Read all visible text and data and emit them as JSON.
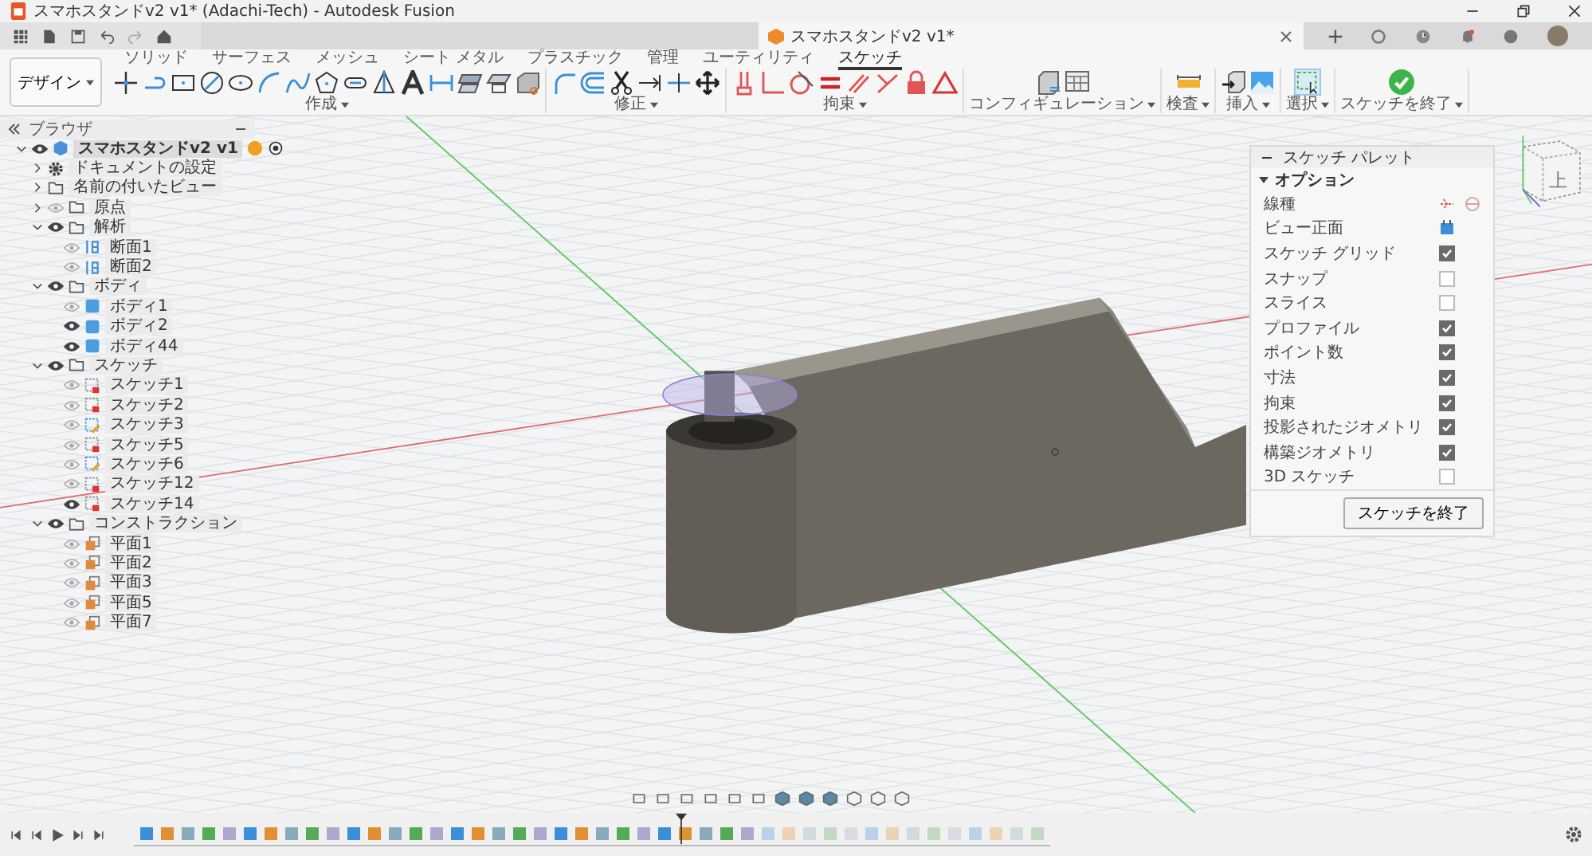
{
  "window": {
    "title": "スマホスタンドv2 v1* (Adachi-Tech) - Autodesk Fusion"
  },
  "document_tab": {
    "title": "スマホスタンドv2 v1*"
  },
  "workspace": {
    "label": "デザイン"
  },
  "toolbar_tabs": [
    {
      "label": "ソリッド",
      "selected": false
    },
    {
      "label": "サーフェス",
      "selected": false
    },
    {
      "label": "メッシュ",
      "selected": false
    },
    {
      "label": "シート メタル",
      "selected": false
    },
    {
      "label": "プラスチック",
      "selected": false
    },
    {
      "label": "管理",
      "selected": false
    },
    {
      "label": "ユーティリティ",
      "selected": false
    },
    {
      "label": "スケッチ",
      "selected": true
    }
  ],
  "tool_groups": [
    {
      "label": "作成"
    },
    {
      "label": "修正"
    },
    {
      "label": "拘束"
    },
    {
      "label": "コンフィギュレーション"
    },
    {
      "label": "検査"
    },
    {
      "label": "挿入"
    },
    {
      "label": "選択"
    },
    {
      "label": "スケッチを終了"
    }
  ],
  "browser": {
    "title": "ブラウザ",
    "root": {
      "label": "スマホスタンドv2 v1",
      "kind": "component",
      "visible": true,
      "expanded": true,
      "children": [
        {
          "label": "ドキュメントの設定",
          "kind": "settings",
          "expanded": false
        },
        {
          "label": "名前の付いたビュー",
          "kind": "folder",
          "expanded": false
        },
        {
          "label": "原点",
          "kind": "folder",
          "visible": false,
          "expanded": false
        },
        {
          "label": "解析",
          "kind": "folder",
          "visible": true,
          "expanded": true,
          "children": [
            {
              "label": "断面1",
              "kind": "section",
              "visible": false
            },
            {
              "label": "断面2",
              "kind": "section",
              "visible": false
            }
          ]
        },
        {
          "label": "ボディ",
          "kind": "folder",
          "visible": true,
          "expanded": true,
          "children": [
            {
              "label": "ボディ1",
              "kind": "body",
              "visible": false
            },
            {
              "label": "ボディ2",
              "kind": "body",
              "visible": true
            },
            {
              "label": "ボディ44",
              "kind": "body",
              "visible": true
            }
          ]
        },
        {
          "label": "スケッチ",
          "kind": "folder",
          "visible": true,
          "expanded": true,
          "children": [
            {
              "label": "スケッチ1",
              "kind": "sketch",
              "visible": false
            },
            {
              "label": "スケッチ2",
              "kind": "sketch",
              "visible": false
            },
            {
              "label": "スケッチ3",
              "kind": "sketchedit",
              "visible": false
            },
            {
              "label": "スケッチ5",
              "kind": "sketch",
              "visible": false
            },
            {
              "label": "スケッチ6",
              "kind": "sketchedit",
              "visible": false
            },
            {
              "label": "スケッチ12",
              "kind": "sketch",
              "visible": false
            },
            {
              "label": "スケッチ14",
              "kind": "sketch",
              "visible": true
            }
          ]
        },
        {
          "label": "コンストラクション",
          "kind": "folder",
          "visible": true,
          "expanded": true,
          "children": [
            {
              "label": "平面1",
              "kind": "plane",
              "visible": false
            },
            {
              "label": "平面2",
              "kind": "plane",
              "visible": false
            },
            {
              "label": "平面3",
              "kind": "plane",
              "visible": false
            },
            {
              "label": "平面5",
              "kind": "plane",
              "visible": false
            },
            {
              "label": "平面7",
              "kind": "plane",
              "visible": false
            }
          ]
        }
      ]
    }
  },
  "sketch_palette": {
    "title": "スケッチ パレット",
    "section": {
      "label": "オプション",
      "expanded": true
    },
    "rows": [
      {
        "label": "線種",
        "kind": "linetype"
      },
      {
        "label": "ビュー正面",
        "kind": "action"
      },
      {
        "label": "スケッチ グリッド",
        "kind": "checkbox",
        "checked": true
      },
      {
        "label": "スナップ",
        "kind": "checkbox",
        "checked": false
      },
      {
        "label": "スライス",
        "kind": "checkbox",
        "checked": false
      },
      {
        "label": "プロファイル",
        "kind": "checkbox",
        "checked": true
      },
      {
        "label": "ポイント数",
        "kind": "checkbox",
        "checked": true
      },
      {
        "label": "寸法",
        "kind": "checkbox",
        "checked": true
      },
      {
        "label": "拘束",
        "kind": "checkbox",
        "checked": true
      },
      {
        "label": "投影されたジオメトリ",
        "kind": "checkbox",
        "checked": true
      },
      {
        "label": "構築ジオメトリ",
        "kind": "checkbox",
        "checked": true
      },
      {
        "label": "3D スケッチ",
        "kind": "checkbox",
        "checked": false
      }
    ],
    "finish_button": "スケッチを終了"
  },
  "view_cube": {
    "face": "上"
  }
}
